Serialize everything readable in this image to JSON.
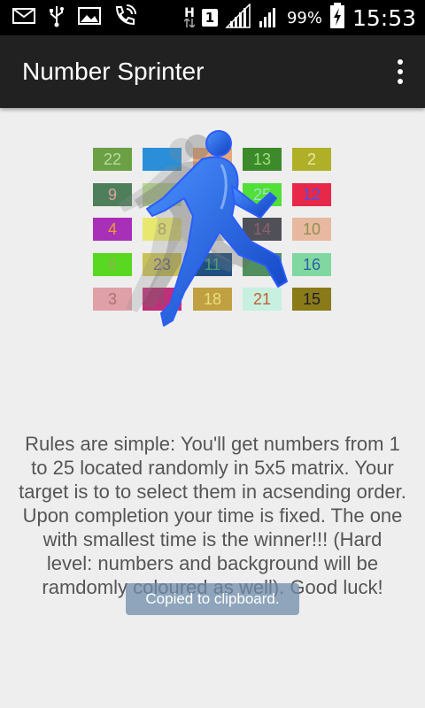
{
  "status_bar": {
    "signal_label": "H",
    "sim": "1",
    "battery": "99%",
    "time": "15:53",
    "icons": [
      "mail-icon",
      "usb-icon",
      "image-icon",
      "wifi-call-icon",
      "data-arrows-icon",
      "sim-icon",
      "signal-icon",
      "signal-icon",
      "battery-charging-icon"
    ]
  },
  "app_bar": {
    "title": "Number Sprinter",
    "menu_icon": "overflow-menu-icon"
  },
  "logo": {
    "cells": [
      {
        "n": "22",
        "bg": "#6ca044",
        "fg": "#b9dca0"
      },
      {
        "n": "",
        "bg": "#2a8fd8",
        "fg": "#2a8fd8"
      },
      {
        "n": "",
        "bg": "#e8a878",
        "fg": "#e8a878"
      },
      {
        "n": "13",
        "bg": "#3c8a2a",
        "fg": "#9ee07a"
      },
      {
        "n": "2",
        "bg": "#b0b028",
        "fg": "#e8e8a0"
      },
      {
        "n": "9",
        "bg": "#4f7f5a",
        "fg": "#e0a0a0"
      },
      {
        "n": "",
        "bg": "#b8d890",
        "fg": "#b8d890"
      },
      {
        "n": "",
        "bg": "#e89088",
        "fg": "#e89088"
      },
      {
        "n": "25",
        "bg": "#50e038",
        "fg": "#9ee0c0"
      },
      {
        "n": "12",
        "bg": "#e82848",
        "fg": "#5050e0"
      },
      {
        "n": "4",
        "bg": "#a830b8",
        "fg": "#e8a030"
      },
      {
        "n": "8",
        "bg": "#e8e870",
        "fg": "#b0a060"
      },
      {
        "n": "",
        "bg": "#c8c8c8",
        "fg": "#c8c8c8"
      },
      {
        "n": "14",
        "bg": "#505058",
        "fg": "#906070"
      },
      {
        "n": "10",
        "bg": "#e8b8a0",
        "fg": "#909050"
      },
      {
        "n": "6",
        "bg": "#58d820",
        "fg": "#90b050"
      },
      {
        "n": "23",
        "bg": "#c8c058",
        "fg": "#706088"
      },
      {
        "n": "11",
        "bg": "#205080",
        "fg": "#40a070"
      },
      {
        "n": "",
        "bg": "#509060",
        "fg": "#509060"
      },
      {
        "n": "16",
        "bg": "#80d8a0",
        "fg": "#3060a0"
      },
      {
        "n": "3",
        "bg": "#e0a0a8",
        "fg": "#b07070"
      },
      {
        "n": "1",
        "bg": "#c03078",
        "fg": "#805070"
      },
      {
        "n": "18",
        "bg": "#c0a040",
        "fg": "#e8e080"
      },
      {
        "n": "21",
        "bg": "#c8f0e0",
        "fg": "#c06030"
      },
      {
        "n": "15",
        "bg": "#8a7a18",
        "fg": "#202020"
      }
    ]
  },
  "rules_text": "Rules are simple: You'll get numbers from 1 to 25 located randomly in 5x5 matrix. Your target is to to select them in acsending order. Upon completion your time is fixed. The one with smallest time is the winner!!! (Hard level: numbers and background will be ramdomly coloured as well). Good luck!",
  "toast": "Copied to clipboard."
}
